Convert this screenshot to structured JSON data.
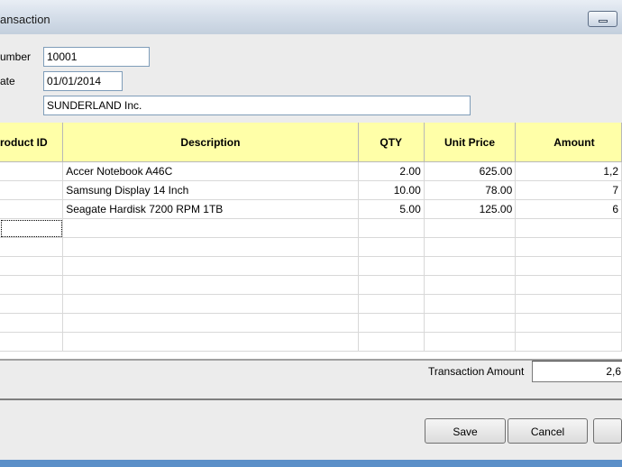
{
  "window": {
    "title": "ansaction"
  },
  "form": {
    "number_label": "umber",
    "number_value": "10001",
    "date_label": "ate",
    "date_value": "01/01/2014",
    "customer_value": "SUNDERLAND Inc."
  },
  "grid": {
    "headers": [
      "roduct ID",
      "Description",
      "QTY",
      "Unit Price",
      "Amount"
    ],
    "rows": [
      [
        "",
        "Accer Notebook A46C",
        "2.00",
        "625.00",
        "1,2"
      ],
      [
        "",
        "Samsung Display 14 Inch",
        "10.00",
        "78.00",
        "7"
      ],
      [
        "",
        "Seagate Hardisk 7200 RPM 1TB",
        "5.00",
        "125.00",
        "6"
      ]
    ]
  },
  "summary": {
    "label": "Transaction Amount",
    "value": "2,6"
  },
  "buttons": {
    "save": "Save",
    "cancel": "Cancel"
  },
  "colors": {
    "header_bg": "#ffffa8",
    "status_bar": "#5b8fc8"
  }
}
